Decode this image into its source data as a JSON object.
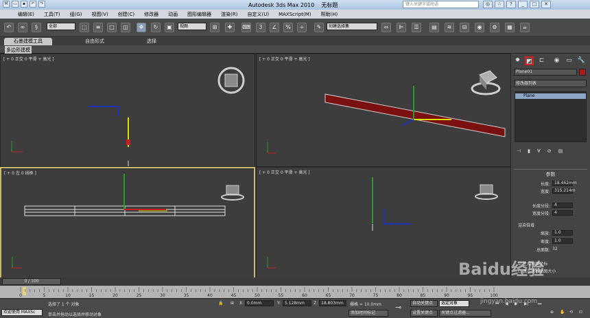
{
  "app": {
    "title": "Autodesk 3ds Max  2010",
    "doc": "无标题",
    "search_placeholder": "键入关键字或短语"
  },
  "menu": [
    "编辑(E)",
    "工具(T)",
    "组(G)",
    "视图(V)",
    "创建(C)",
    "修改器",
    "动画",
    "图形编辑器",
    "渲染(R)",
    "自定义(U)",
    "MAXScript(M)",
    "帮助(H)"
  ],
  "toolbar": {
    "filter": "全部",
    "coord": "视图",
    "selset": "创建选择集"
  },
  "ribbon": {
    "tabs": [
      "石墨建模工具",
      "自由形式",
      "选择"
    ],
    "subtab": "多边形建模"
  },
  "viewports": {
    "top": "[ + 0 正交 0 平滑 + 高光 ]",
    "persp": "[ + 0 正交 0 平滑 + 高光 ]",
    "left": "[ + 0 左 0 线框 ]",
    "bottom_right": "[ + 0 正交 0 平滑 + 高光 ]"
  },
  "cmd": {
    "object_name": "Plane01",
    "modifier_list": "修改器列表",
    "stack_item": "Plane",
    "params_title": "参数",
    "length_label": "长度:",
    "length_val": "18.462mm",
    "width_label": "宽度:",
    "width_val": "315.214m",
    "lseg_label": "长度分段:",
    "lseg_val": "4",
    "wseg_label": "宽度分段:",
    "wseg_val": "4",
    "render_group": "渲染倍增",
    "scale_label": "缩放:",
    "scale_val": "1.0",
    "density_label": "密度:",
    "density_val": "1.0",
    "total_faces_label": "总面数:",
    "total_faces_val": "32",
    "map_coords": "生成贴图坐标",
    "real_world": "真实世界贴图大小"
  },
  "timeline": {
    "slider": "0 / 100",
    "ticks": [
      "0",
      "5",
      "10",
      "15",
      "20",
      "25",
      "30",
      "35",
      "40",
      "45",
      "50",
      "55",
      "60",
      "65",
      "70",
      "75",
      "80",
      "85",
      "90",
      "95",
      "100"
    ]
  },
  "status": {
    "welcome": "欢迎使用 MAXSc",
    "selected": "选择了 1 个 对象",
    "prompt": "单击并拖动以选择并移动对象",
    "x_label": "X:",
    "x_val": "0.0mm",
    "y_label": "Y:",
    "y_val": "5.128mm",
    "z_label": "Z:",
    "z_val": "18.803mm",
    "grid": "栅格 = 10.0mm",
    "autokey": "自动关键点",
    "setkey": "设置关键点",
    "selobj": "选定对象",
    "keyfilter": "关键点过滤器...",
    "addtime": "添加时间标记"
  },
  "watermark": {
    "main": "Baidu经验",
    "sub": "jingyan.baidu.com"
  },
  "colors": {
    "highlight_red": "#d42020",
    "plane_red": "#7a1010",
    "axis_y": "#2a9a2a",
    "axis_x": "#c82020"
  }
}
